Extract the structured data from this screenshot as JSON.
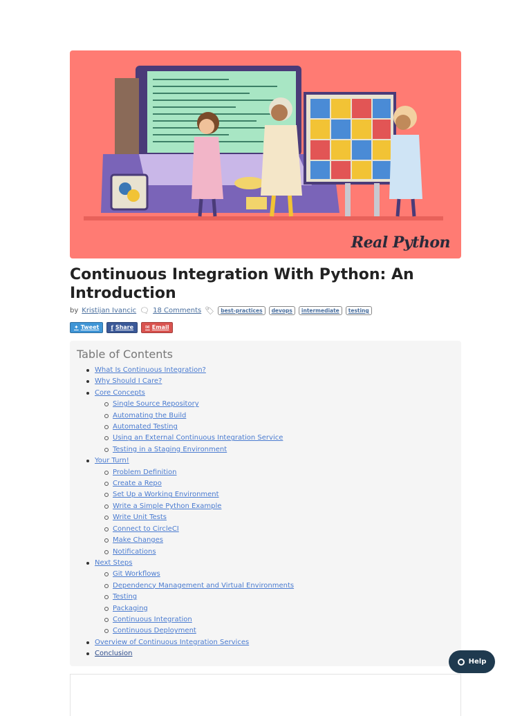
{
  "hero": {
    "brand": "Real Python",
    "alt": "Continuous Integration With Python: An Introduction"
  },
  "article": {
    "title": "Continuous Integration With Python: An Introduction",
    "by": "by",
    "author": "Kristijan Ivancic",
    "comments": "18 Comments",
    "tags": [
      "best-practices",
      "devops",
      "intermediate",
      "testing"
    ]
  },
  "share": {
    "tweet": "Tweet",
    "share": "Share",
    "email": "Email"
  },
  "toc": {
    "title": "Table of Contents",
    "items": [
      {
        "label": "What Is Continuous Integration?",
        "children": []
      },
      {
        "label": "Why Should I Care?",
        "children": []
      },
      {
        "label": "Core Concepts",
        "children": [
          "Single Source Repository",
          "Automating the Build",
          "Automated Testing",
          "Using an External Continuous Integration Service",
          "Testing in a Staging Environment"
        ]
      },
      {
        "label": "Your Turn!",
        "children": [
          "Problem Definition",
          "Create a Repo",
          "Set Up a Working Environment",
          "Write a Simple Python Example",
          "Write Unit Tests",
          "Connect to CircleCI",
          "Make Changes",
          "Notifications"
        ]
      },
      {
        "label": "Next Steps",
        "children": [
          "Git Workflows",
          "Dependency Management and Virtual Environments",
          "Testing",
          "Packaging",
          "Continuous Integration",
          "Continuous Deployment"
        ]
      },
      {
        "label": "Overview of Continuous Integration Services",
        "children": []
      },
      {
        "label": "Conclusion",
        "children": [],
        "active": true
      }
    ]
  },
  "help": {
    "label": "Help"
  },
  "colors": {
    "hero_bg": "#ff7b73",
    "link": "#4a7bd0",
    "help_bg": "#1f3a4f"
  }
}
